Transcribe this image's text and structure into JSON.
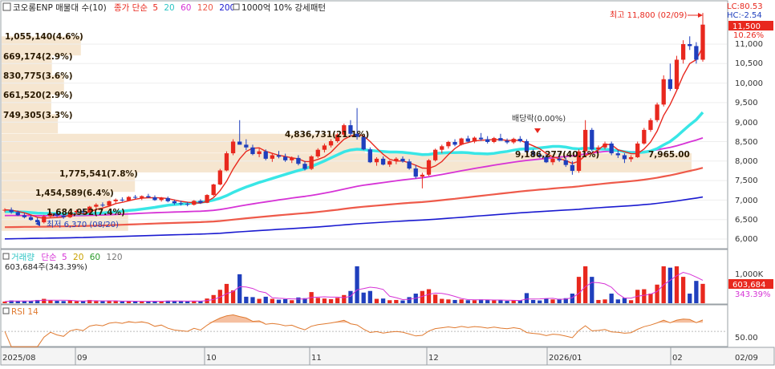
{
  "header": {
    "stock_name": "코오롱ENP 매물대 수(10)",
    "ma_label": "종가 단순",
    "ma_periods": [
      "5",
      "20",
      "60",
      "120",
      "200"
    ],
    "pattern_note": "1000억 10% 강세패턴",
    "lc_label": "LC:80.53",
    "hc_label": "HC:-2.54"
  },
  "price_pane": {
    "high_annotation": "최고 11,800 (02/09)",
    "low_annotation": "최저 6,370 (08/20)",
    "dividend_annotation": "배당락(0.00%)",
    "current_price_box": "11,500",
    "current_change_box": "10.26%",
    "volume_profile_labels": [
      "1,055,140(4.6%)",
      "669,174(2.9%)",
      "830,775(3.6%)",
      "661,520(2.9%)",
      "749,305(3.3%)",
      "4,836,731(21.1%)",
      "9,186,277(40.1%)",
      "1,775,541(7.8%)",
      "1,454,589(6.4%)",
      "1,684,952(7.4%)"
    ],
    "lower_overlap_label": "7,965.00",
    "y_ticks": [
      "11,000",
      "10,500",
      "10,000",
      "9,500",
      "9,000",
      "8,500",
      "8,000",
      "7,500",
      "7,000",
      "6,500",
      "6,000"
    ]
  },
  "volume_pane": {
    "title_label": "거래량",
    "ma_label": "단순",
    "ma_periods": [
      "5",
      "20",
      "60",
      "120"
    ],
    "current_volume_text": "603,684주(343.39%)",
    "axis_tick": "1,000K",
    "current_volume_box": "603,684",
    "current_ratio_box": "343.39%"
  },
  "rsi_pane": {
    "title_label": "RSI 14",
    "axis_tick": "50.00"
  },
  "x_axis": {
    "labels": [
      "2025/08",
      "09",
      "10",
      "11",
      "12",
      "2026/01",
      "02",
      "02/09"
    ]
  },
  "colors": {
    "up": "#e8281e",
    "down": "#1f3fbd",
    "ma5": "#e8281e",
    "ma20": "#39e6e6",
    "ma60": "#d633d6",
    "ma120": "#ee5a4a",
    "ma200": "#1a1ad0",
    "profile": "#f5e2c8",
    "rsi": "#e07a30",
    "volume_ma": "#d633d6"
  },
  "chart_data": {
    "type": "candlestick",
    "date_range": [
      "2025/08",
      "2026/02/09"
    ],
    "ohlc_approx": [
      [
        6730,
        6790,
        6690,
        6750
      ],
      [
        6750,
        6810,
        6650,
        6690
      ],
      [
        6690,
        6730,
        6590,
        6610
      ],
      [
        6610,
        6670,
        6530,
        6560
      ],
      [
        6560,
        6610,
        6470,
        6490
      ],
      [
        6490,
        6550,
        6370,
        6430
      ],
      [
        6430,
        6620,
        6400,
        6580
      ],
      [
        6580,
        6700,
        6540,
        6660
      ],
      [
        6660,
        6700,
        6560,
        6600
      ],
      [
        6600,
        6650,
        6520,
        6560
      ],
      [
        6560,
        6700,
        6540,
        6680
      ],
      [
        6680,
        6760,
        6640,
        6720
      ],
      [
        6720,
        6780,
        6650,
        6690
      ],
      [
        6690,
        6850,
        6670,
        6830
      ],
      [
        6830,
        6920,
        6790,
        6880
      ],
      [
        6880,
        6940,
        6820,
        6860
      ],
      [
        6860,
        6990,
        6840,
        6970
      ],
      [
        6970,
        7040,
        6920,
        7010
      ],
      [
        7010,
        7070,
        6960,
        6990
      ],
      [
        6990,
        7100,
        6970,
        7080
      ],
      [
        7080,
        7130,
        7030,
        7060
      ],
      [
        7060,
        7120,
        7000,
        7100
      ],
      [
        7100,
        7160,
        7050,
        7070
      ],
      [
        7070,
        7120,
        6980,
        7000
      ],
      [
        7000,
        7080,
        6960,
        7050
      ],
      [
        7050,
        7090,
        6940,
        6970
      ],
      [
        6970,
        7010,
        6880,
        6920
      ],
      [
        6920,
        6980,
        6860,
        6900
      ],
      [
        6900,
        6950,
        6840,
        6880
      ],
      [
        6880,
        7000,
        6860,
        6980
      ],
      [
        6980,
        7020,
        6900,
        6930
      ],
      [
        6930,
        7150,
        6920,
        7130
      ],
      [
        7130,
        7420,
        7100,
        7400
      ],
      [
        7400,
        7800,
        7380,
        7760
      ],
      [
        7760,
        8250,
        7740,
        8200
      ],
      [
        8200,
        8560,
        8150,
        8500
      ],
      [
        8500,
        9050,
        8420,
        8420
      ],
      [
        8420,
        8560,
        8280,
        8350
      ],
      [
        8350,
        8420,
        8150,
        8180
      ],
      [
        8180,
        8320,
        8100,
        8250
      ],
      [
        8250,
        8300,
        8020,
        8060
      ],
      [
        8060,
        8200,
        7980,
        8150
      ],
      [
        8150,
        8260,
        8070,
        8110
      ],
      [
        8110,
        8190,
        7980,
        8020
      ],
      [
        8020,
        8120,
        7950,
        8080
      ],
      [
        8080,
        8150,
        7890,
        7930
      ],
      [
        7930,
        8000,
        7760,
        7800
      ],
      [
        7800,
        8150,
        7770,
        8120
      ],
      [
        8120,
        8330,
        8080,
        8290
      ],
      [
        8290,
        8450,
        8220,
        8400
      ],
      [
        8400,
        8560,
        8350,
        8510
      ],
      [
        8510,
        8720,
        8470,
        8680
      ],
      [
        8680,
        8960,
        8640,
        8920
      ],
      [
        8920,
        9050,
        8650,
        8700
      ],
      [
        8700,
        9360,
        8550,
        8620
      ],
      [
        8620,
        8650,
        8280,
        8300
      ],
      [
        8300,
        8350,
        7950,
        7970
      ],
      [
        7970,
        8100,
        7880,
        8060
      ],
      [
        8060,
        8120,
        7890,
        7910
      ],
      [
        7910,
        8020,
        7850,
        8000
      ],
      [
        8000,
        8100,
        7920,
        8060
      ],
      [
        8060,
        8120,
        7960,
        7990
      ],
      [
        7990,
        8050,
        7780,
        7810
      ],
      [
        7810,
        7900,
        7550,
        7600
      ],
      [
        7600,
        7700,
        7300,
        7650
      ],
      [
        7650,
        8050,
        7620,
        8020
      ],
      [
        8020,
        8320,
        7990,
        8290
      ],
      [
        8290,
        8420,
        8200,
        8380
      ],
      [
        8380,
        8520,
        8320,
        8490
      ],
      [
        8490,
        8560,
        8380,
        8420
      ],
      [
        8420,
        8600,
        8400,
        8580
      ],
      [
        8580,
        8650,
        8480,
        8500
      ],
      [
        8500,
        8630,
        8460,
        8600
      ],
      [
        8600,
        8720,
        8520,
        8560
      ],
      [
        8560,
        8640,
        8450,
        8490
      ],
      [
        8490,
        8620,
        8460,
        8590
      ],
      [
        8590,
        8700,
        8530,
        8520
      ],
      [
        8520,
        8580,
        8440,
        8480
      ],
      [
        8480,
        8600,
        8440,
        8570
      ],
      [
        8570,
        8640,
        8480,
        8510
      ],
      [
        8510,
        8560,
        8200,
        8230
      ],
      [
        8230,
        8300,
        8120,
        8160
      ],
      [
        8160,
        8240,
        8080,
        8110
      ],
      [
        8110,
        8180,
        7950,
        7970
      ],
      [
        7970,
        8100,
        7900,
        8060
      ],
      [
        8060,
        8200,
        7980,
        8020
      ],
      [
        8020,
        8090,
        7850,
        7900
      ],
      [
        7900,
        8000,
        7650,
        7750
      ],
      [
        7750,
        8300,
        7700,
        8250
      ],
      [
        8250,
        9050,
        8200,
        8800
      ],
      [
        8800,
        8850,
        8250,
        8300
      ],
      [
        8300,
        8400,
        8220,
        8350
      ],
      [
        8350,
        8500,
        8300,
        8450
      ],
      [
        8450,
        8500,
        8150,
        8200
      ],
      [
        8200,
        8280,
        8080,
        8150
      ],
      [
        8150,
        8200,
        7950,
        8050
      ],
      [
        8050,
        8150,
        7980,
        8100
      ],
      [
        8100,
        8500,
        8080,
        8450
      ],
      [
        8450,
        8850,
        8420,
        8800
      ],
      [
        8800,
        9100,
        8750,
        9050
      ],
      [
        9050,
        9500,
        9000,
        9450
      ],
      [
        9450,
        10200,
        9400,
        10100
      ],
      [
        10100,
        10500,
        9800,
        9850
      ],
      [
        9850,
        10700,
        9800,
        10600
      ],
      [
        10600,
        11100,
        10500,
        11000
      ],
      [
        11000,
        11200,
        10850,
        10950
      ],
      [
        10950,
        11050,
        10500,
        10600
      ],
      [
        10600,
        11800,
        10550,
        11500
      ]
    ],
    "moving_averages_period": [
      "5",
      "20",
      "60",
      "120",
      "200"
    ],
    "y_range": [
      5800,
      11900
    ],
    "volume_profile": {
      "levels": [
        "11,000",
        "10,500",
        "10,000",
        "9,500",
        "9,000",
        "8,500",
        "8,000",
        "7,500",
        "7,000",
        "6,500"
      ],
      "volumes": [
        1055140,
        669174,
        830775,
        661520,
        749305,
        4836731,
        9186277,
        1775541,
        1454589,
        1684952
      ],
      "percents": [
        4.6,
        2.9,
        3.6,
        2.9,
        3.3,
        21.1,
        40.1,
        7.8,
        6.4,
        7.4
      ]
    },
    "volume_last": 603684,
    "volume_ratio_percent": 343.39,
    "rsi_period": 14,
    "rsi_reference": 50
  }
}
